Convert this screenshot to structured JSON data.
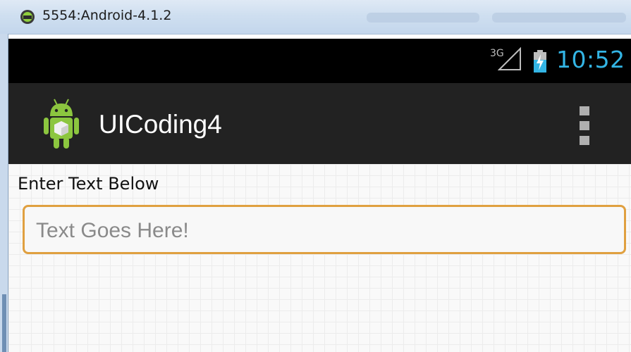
{
  "window": {
    "title": "5554:Android-4.1.2",
    "icon": "android-emulator-icon"
  },
  "status_bar": {
    "network": "3G",
    "time": "10:52",
    "signal_icon": "signal-icon",
    "battery_icon": "battery-icon",
    "clock_color": "#33b5e5"
  },
  "action_bar": {
    "app_name": "UICoding4",
    "app_icon": "android-robot-icon",
    "menu_icon": "overflow-menu-icon"
  },
  "content": {
    "label": "Enter Text Below",
    "text_field": {
      "placeholder": "Text Goes Here!",
      "value": "",
      "focus_color": "#e0a040"
    }
  }
}
